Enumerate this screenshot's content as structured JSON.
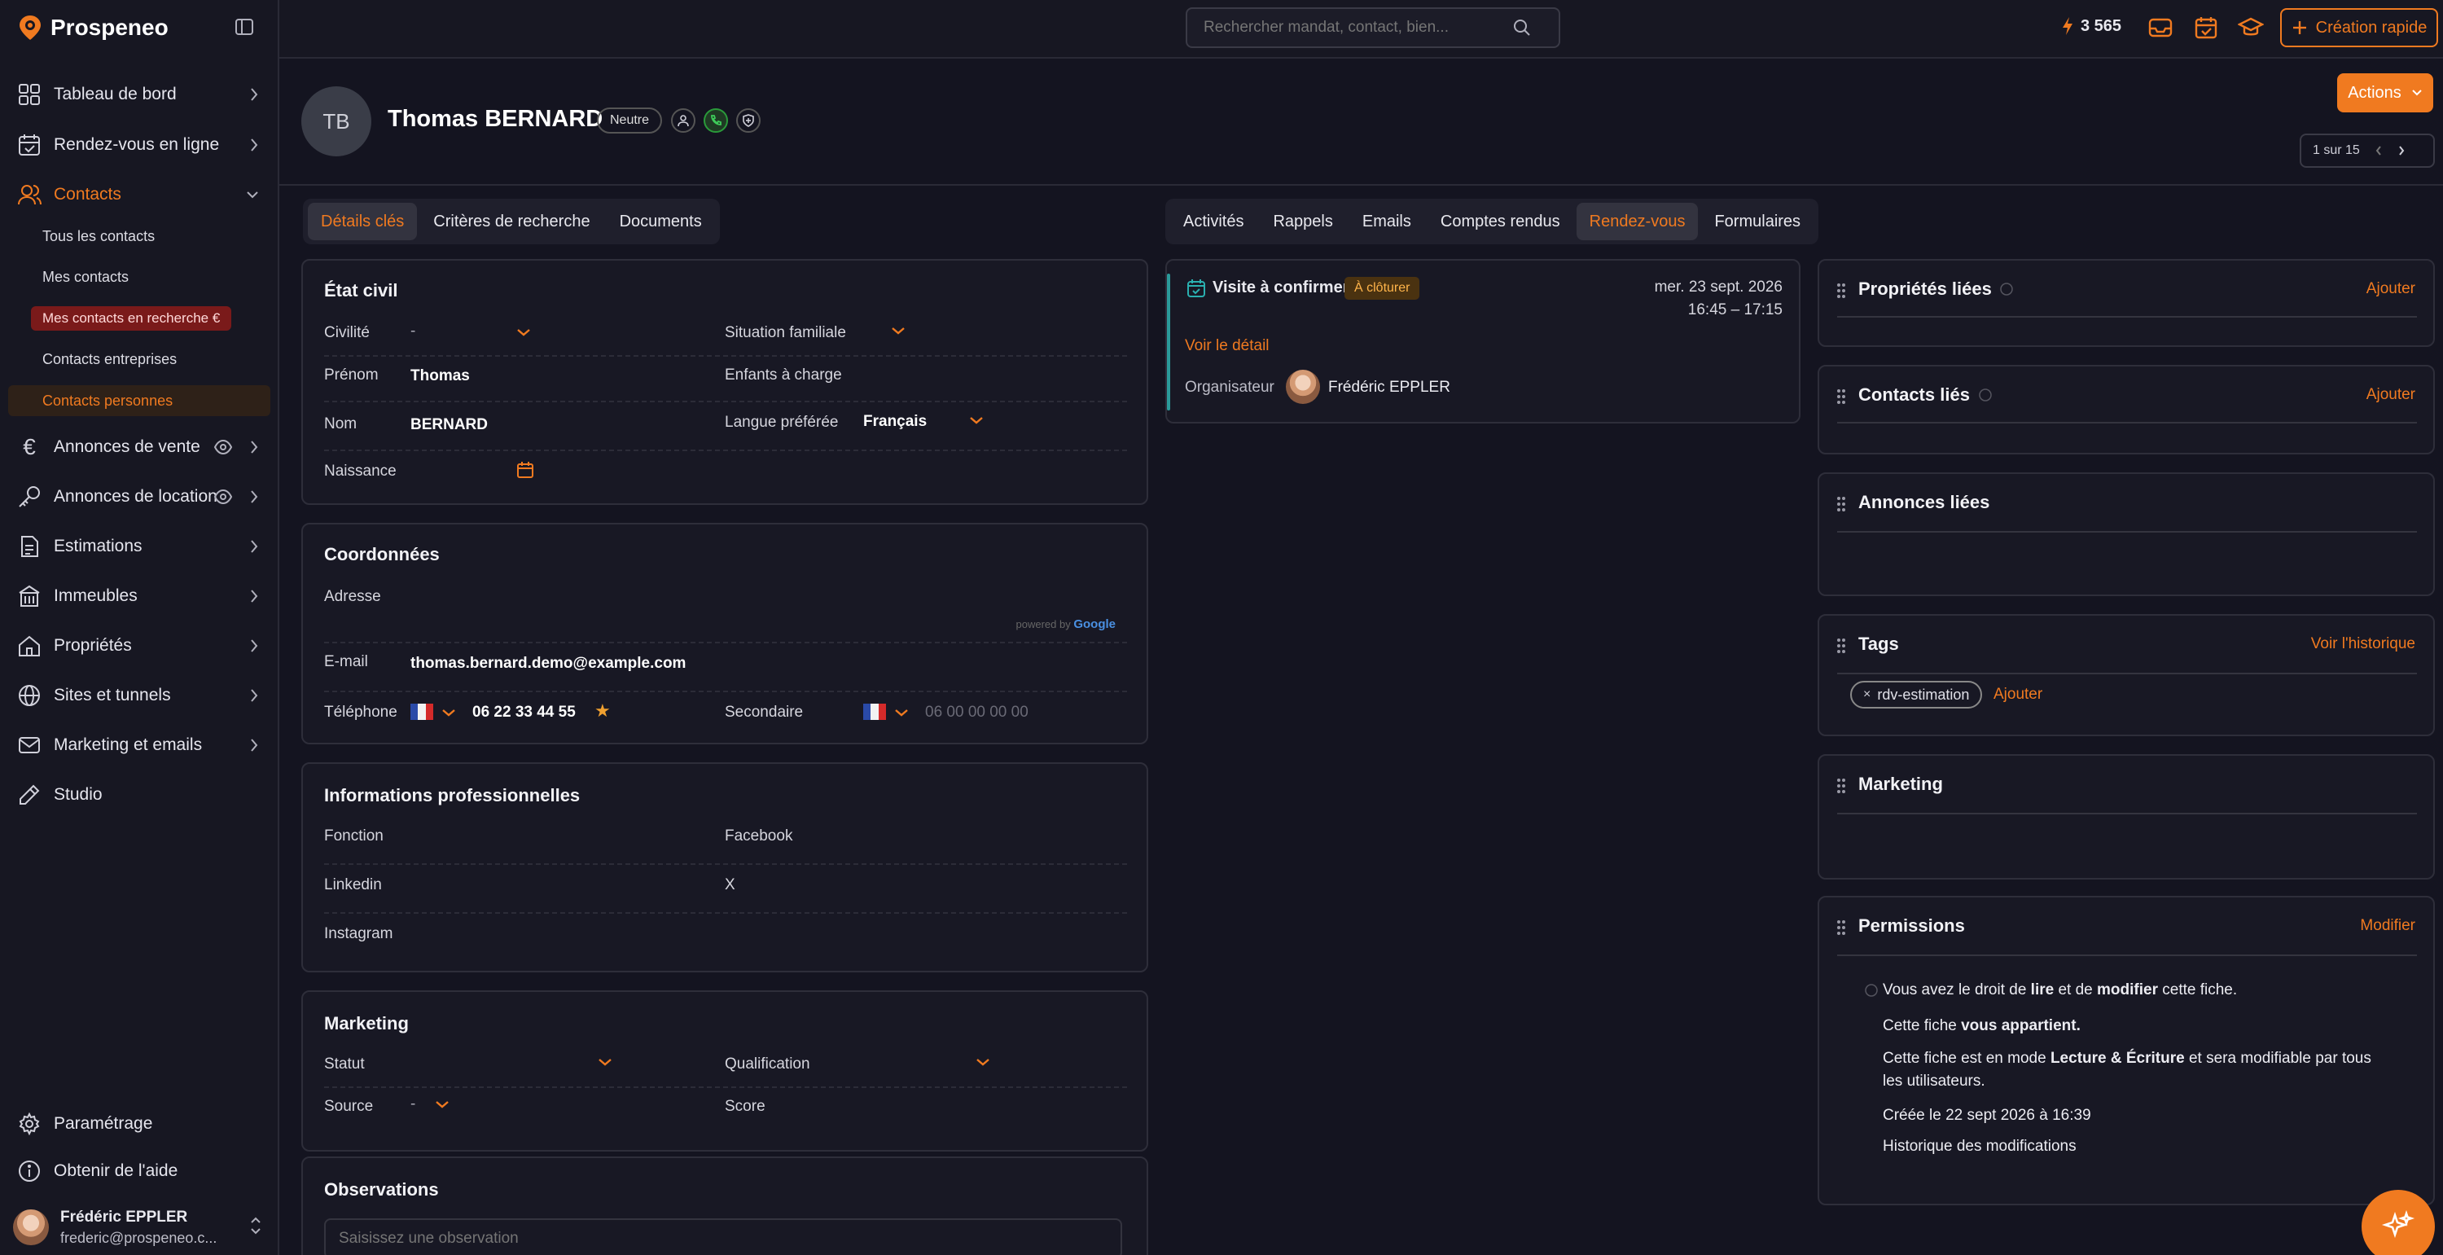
{
  "app": {
    "name": "Prospeneo"
  },
  "sidebar": {
    "items": [
      {
        "label": "Tableau de bord"
      },
      {
        "label": "Rendez-vous en ligne"
      },
      {
        "label": "Contacts"
      },
      {
        "label": "Annonces de vente"
      },
      {
        "label": "Annonces de location"
      },
      {
        "label": "Estimations"
      },
      {
        "label": "Immeubles"
      },
      {
        "label": "Propriétés"
      },
      {
        "label": "Sites et tunnels"
      },
      {
        "label": "Marketing et emails"
      },
      {
        "label": "Studio"
      }
    ],
    "contacts_sub": [
      {
        "label": "Tous les contacts"
      },
      {
        "label": "Mes contacts"
      },
      {
        "label": "Mes contacts en recherche"
      },
      {
        "label": "Contacts entreprises"
      },
      {
        "label": "Contacts personnes"
      }
    ],
    "settings": "Paramétrage",
    "help": "Obtenir de l'aide",
    "user": {
      "name": "Frédéric EPPLER",
      "email": "frederic@prospeneo.c..."
    }
  },
  "topbar": {
    "search_placeholder": "Rechercher mandat, contact, bien...",
    "credits": "3 565",
    "quick_create": "Création rapide"
  },
  "header": {
    "initials": "TB",
    "name": "Thomas BERNARD",
    "status_pill": "Neutre",
    "actions": "Actions",
    "pager": "1 sur 15"
  },
  "left_tabs": [
    "Détails clés",
    "Critères de recherche",
    "Documents"
  ],
  "mid_tabs": [
    "Activités",
    "Rappels",
    "Emails",
    "Comptes rendus",
    "Rendez-vous",
    "Formulaires"
  ],
  "etat_civil": {
    "title": "État civil",
    "civilite_label": "Civilité",
    "civilite_value": "-",
    "situation_label": "Situation familiale",
    "prenom_label": "Prénom",
    "prenom_value": "Thomas",
    "enfants_label": "Enfants à charge",
    "nom_label": "Nom",
    "nom_value": "BERNARD",
    "langue_label": "Langue préférée",
    "langue_value": "Français",
    "naissance_label": "Naissance"
  },
  "coordonnees": {
    "title": "Coordonnées",
    "adresse_label": "Adresse",
    "powered": "powered by",
    "google": "Google",
    "email_label": "E-mail",
    "email_value": "thomas.bernard.demo@example.com",
    "tel_label": "Téléphone",
    "tel_value": "06 22 33 44 55",
    "secondaire_label": "Secondaire",
    "secondaire_placeholder": "06 00 00 00 00"
  },
  "pro": {
    "title": "Informations professionnelles",
    "fonction": "Fonction",
    "facebook": "Facebook",
    "linkedin": "Linkedin",
    "x": "X",
    "instagram": "Instagram"
  },
  "marketing_left": {
    "title": "Marketing",
    "statut": "Statut",
    "qualification": "Qualification",
    "source": "Source",
    "source_value": "-",
    "score": "Score"
  },
  "observations": {
    "title": "Observations",
    "placeholder": "Saisissez une observation"
  },
  "appointment": {
    "title": "Visite à confirmer",
    "badge": "À clôturer",
    "date": "mer. 23 sept. 2026",
    "time": "16:45 – 17:15",
    "detail_link": "Voir le détail",
    "organizer_label": "Organisateur",
    "organizer_name": "Frédéric EPPLER"
  },
  "right": {
    "proprietes": {
      "title": "Propriétés liées",
      "action": "Ajouter"
    },
    "contacts": {
      "title": "Contacts liés",
      "action": "Ajouter"
    },
    "annonces": {
      "title": "Annonces liées"
    },
    "tags": {
      "title": "Tags",
      "action": "Voir l'historique",
      "tag": "rdv-estimation",
      "add": "Ajouter"
    },
    "marketing": {
      "title": "Marketing"
    },
    "permissions": {
      "title": "Permissions",
      "action": "Modifier",
      "line1_a": "Vous avez le droit de ",
      "line1_b": "lire",
      "line1_c": " et de ",
      "line1_d": "modifier",
      "line1_e": " cette fiche.",
      "line2_a": "Cette fiche ",
      "line2_b": "vous appartient.",
      "line3_a": "Cette fiche est en mode ",
      "line3_b": "Lecture & Écriture",
      "line3_c": " et sera modifiable par tous",
      "line3_d": "les utilisateurs.",
      "line4": "Créée le 22 sept 2026 à 16:39",
      "history": "Historique des modifications"
    }
  },
  "colors": {
    "accent": "#f07a20",
    "background": "#141420",
    "card": "#181824"
  }
}
